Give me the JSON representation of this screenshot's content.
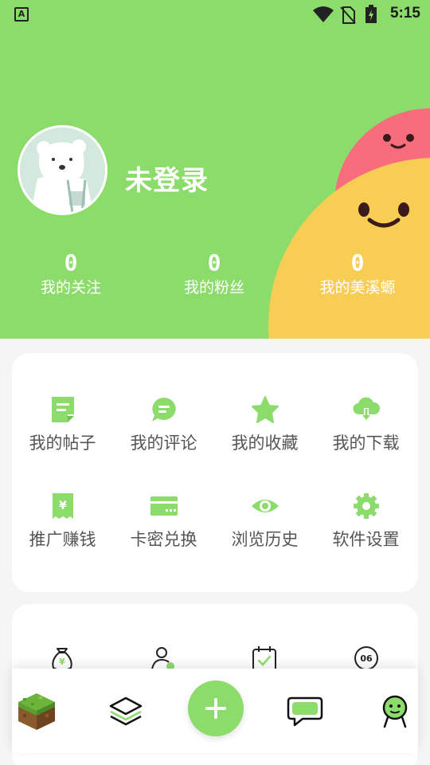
{
  "status_bar": {
    "app_badge": "A",
    "clock": "5:15"
  },
  "profile": {
    "username": "未登录"
  },
  "stats": [
    {
      "value": "0",
      "label": "我的关注"
    },
    {
      "value": "0",
      "label": "我的粉丝"
    },
    {
      "value": "0",
      "label": "我的美溪螈"
    }
  ],
  "menu": {
    "items": [
      {
        "label": "我的帖子",
        "icon": "note-icon"
      },
      {
        "label": "我的评论",
        "icon": "comment-icon"
      },
      {
        "label": "我的收藏",
        "icon": "star-icon"
      },
      {
        "label": "我的下载",
        "icon": "cloud-download-icon"
      },
      {
        "label": "推广赚钱",
        "icon": "yuan-receipt-icon"
      },
      {
        "label": "卡密兑换",
        "icon": "card-icon"
      },
      {
        "label": "浏览历史",
        "icon": "eye-icon"
      },
      {
        "label": "软件设置",
        "icon": "gear-icon"
      }
    ]
  },
  "secondary_icons": [
    "money-bag-icon",
    "user-badge-icon",
    "calendar-check-icon",
    "badge-06-icon"
  ],
  "secondary_badge_text": "06",
  "bottom_nav": {
    "items": [
      "grass-block-icon",
      "layers-icon",
      "plus-icon",
      "chat-icon",
      "profile-icon"
    ]
  },
  "colors": {
    "brand_green": "#8cdc6c",
    "red_blob": "#f76d7e",
    "yellow_blob": "#f8cd54",
    "label_gray": "#555555"
  }
}
